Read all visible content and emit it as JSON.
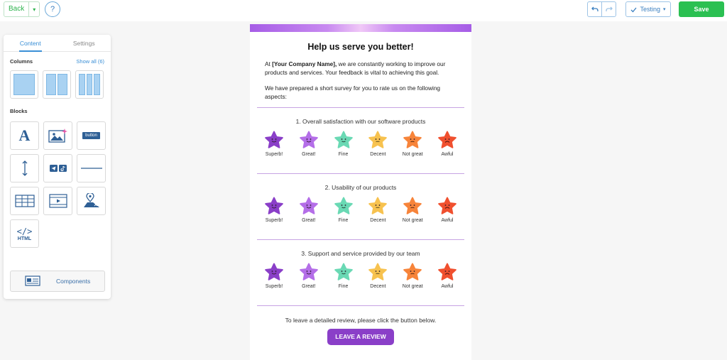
{
  "topbar": {
    "back_label": "Back",
    "help_label": "?",
    "testing_label": "Testing",
    "save_label": "Save"
  },
  "sidebar": {
    "tabs": [
      {
        "label": "Content",
        "active": true
      },
      {
        "label": "Settings",
        "active": false
      }
    ],
    "columns_title": "Columns",
    "show_all_label": "Show all (6)",
    "blocks_title": "Blocks",
    "blocks": [
      "text-icon",
      "image-icon",
      "button-icon",
      "spacer-icon",
      "social-icon",
      "divider-icon",
      "table-icon",
      "video-icon",
      "map-icon",
      "html-icon"
    ],
    "button_block_text": "button",
    "html_block_text": "HTML",
    "components_label": "Components"
  },
  "email": {
    "heading": "Help us serve you better!",
    "intro_prefix": "At ",
    "company": "[Your Company Name],",
    "intro_rest": " we are constantly working to improve our products and services. Your feedback is vital to achieving this goal.",
    "intro_p2": "We have prepared a short survey for you to rate us on the following aspects:",
    "questions": [
      "1. Overall satisfaction with our software products",
      "2. Usability of our products",
      "3. Support and service provided by our team"
    ],
    "ratings": [
      {
        "label": "Superb!",
        "color": "#8a3fc8",
        "mood": "happy"
      },
      {
        "label": "Great!",
        "color": "#b46ee8",
        "mood": "happy"
      },
      {
        "label": "Fine",
        "color": "#6ad9b4",
        "mood": "smile"
      },
      {
        "label": "Decent",
        "color": "#f7c24f",
        "mood": "neutral"
      },
      {
        "label": "Not great",
        "color": "#f7843a",
        "mood": "meh"
      },
      {
        "label": "Awful",
        "color": "#f0502f",
        "mood": "sad"
      }
    ],
    "cta_text": "To leave a detailed review, please click the button below.",
    "review_button": "LEAVE A REVIEW"
  },
  "colors": {
    "accent_green": "#2bc052",
    "accent_blue": "#3a8fd6",
    "brand_purple": "#8a3fc8"
  }
}
